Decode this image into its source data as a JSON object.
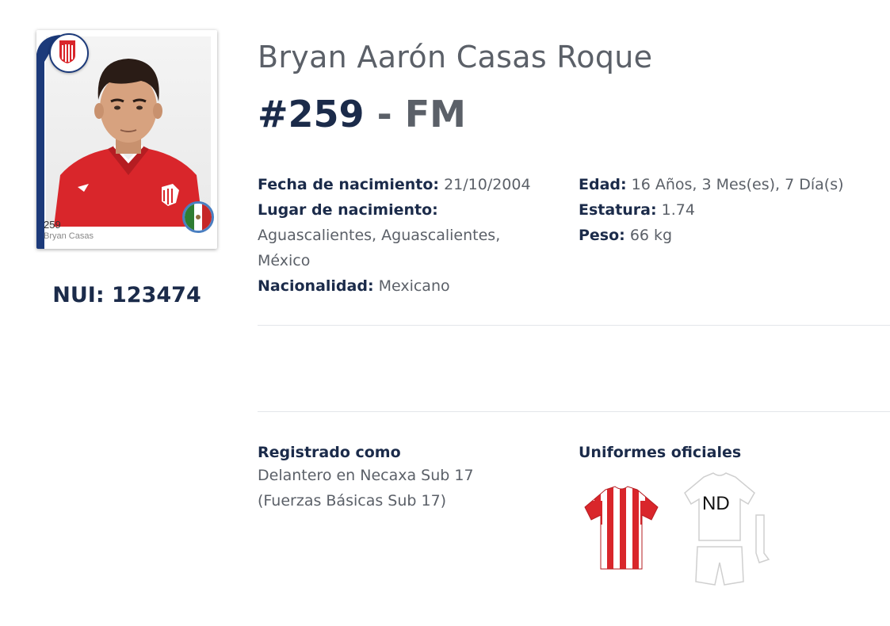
{
  "card": {
    "number": "259",
    "name": "Bryan Casas"
  },
  "nui": "NUI: 123474",
  "player": {
    "full_name": "Bryan Aarón Casas Roque",
    "number": "#259",
    "separator": " - ",
    "position": "FM"
  },
  "details_left": {
    "birthdate_label": "Fecha de nacimiento:",
    "birthdate_value": "21/10/2004",
    "birthplace_label": "Lugar de nacimiento:",
    "birthplace_line1": "Aguascalientes, Aguascalientes,",
    "birthplace_line2": "México",
    "nationality_label": "Nacionalidad:",
    "nationality_value": "Mexicano"
  },
  "details_right": {
    "age_label": "Edad:",
    "age_value": "16 Años, 3 Mes(es), 7 Día(s)",
    "height_label": "Estatura:",
    "height_value": "1.74",
    "weight_label": "Peso:",
    "weight_value": "66 kg"
  },
  "registered": {
    "title": "Registrado como",
    "line1": "Delantero en Necaxa Sub 17",
    "line2": "(Fuerzas Básicas Sub 17)"
  },
  "uniforms": {
    "title": "Uniformes oficiales",
    "away_label": "ND"
  },
  "colors": {
    "navy": "#1b2b4a",
    "kit_red": "#d9262b",
    "sticker_blue": "#1c3a7a"
  }
}
